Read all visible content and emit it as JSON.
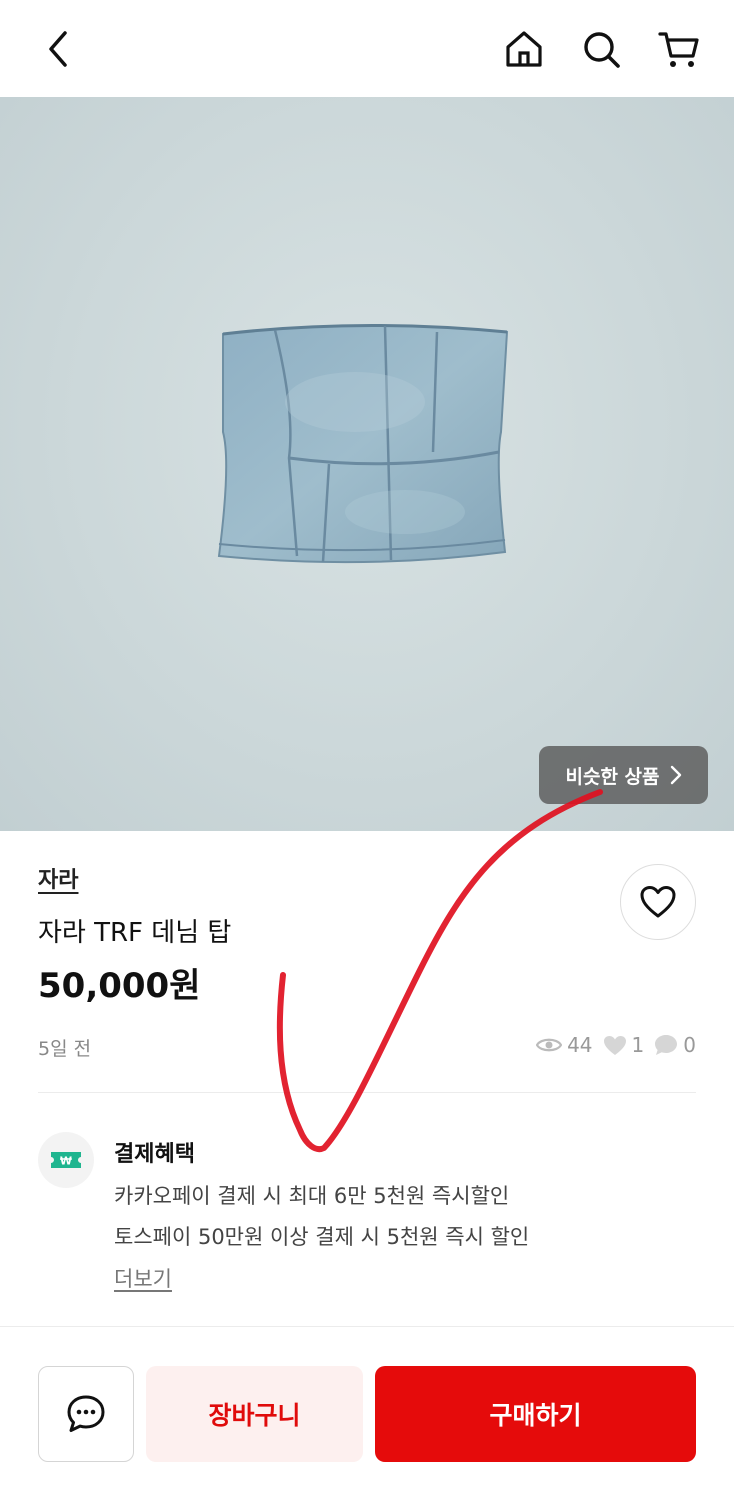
{
  "topbar": {
    "back_icon": "chevron-left-icon",
    "home_icon": "home-icon",
    "search_icon": "search-icon",
    "cart_icon": "cart-icon"
  },
  "product": {
    "similar_button_label": "비슷한 상품",
    "brand": "자라",
    "title": "자라 TRF 데님 탑",
    "price": "50,000원",
    "posted": "5일 전",
    "stats": {
      "views": "44",
      "likes": "1",
      "comments": "0"
    }
  },
  "benefits": {
    "title": "결제혜택",
    "icon_text": "₩",
    "lines": [
      "카카오페이 결제 시 최대 6만 5천원 즉시할인",
      "토스페이 50만원 이상 결제 시 5천원 즉시 할인"
    ],
    "more_label": "더보기"
  },
  "actions": {
    "cart_label": "장바구니",
    "buy_label": "구매하기"
  },
  "colors": {
    "accent": "#e50b0b",
    "cart_button_bg": "#fdf0ef",
    "benefit_icon": "#1fb58f",
    "annotation": "#e01020"
  }
}
